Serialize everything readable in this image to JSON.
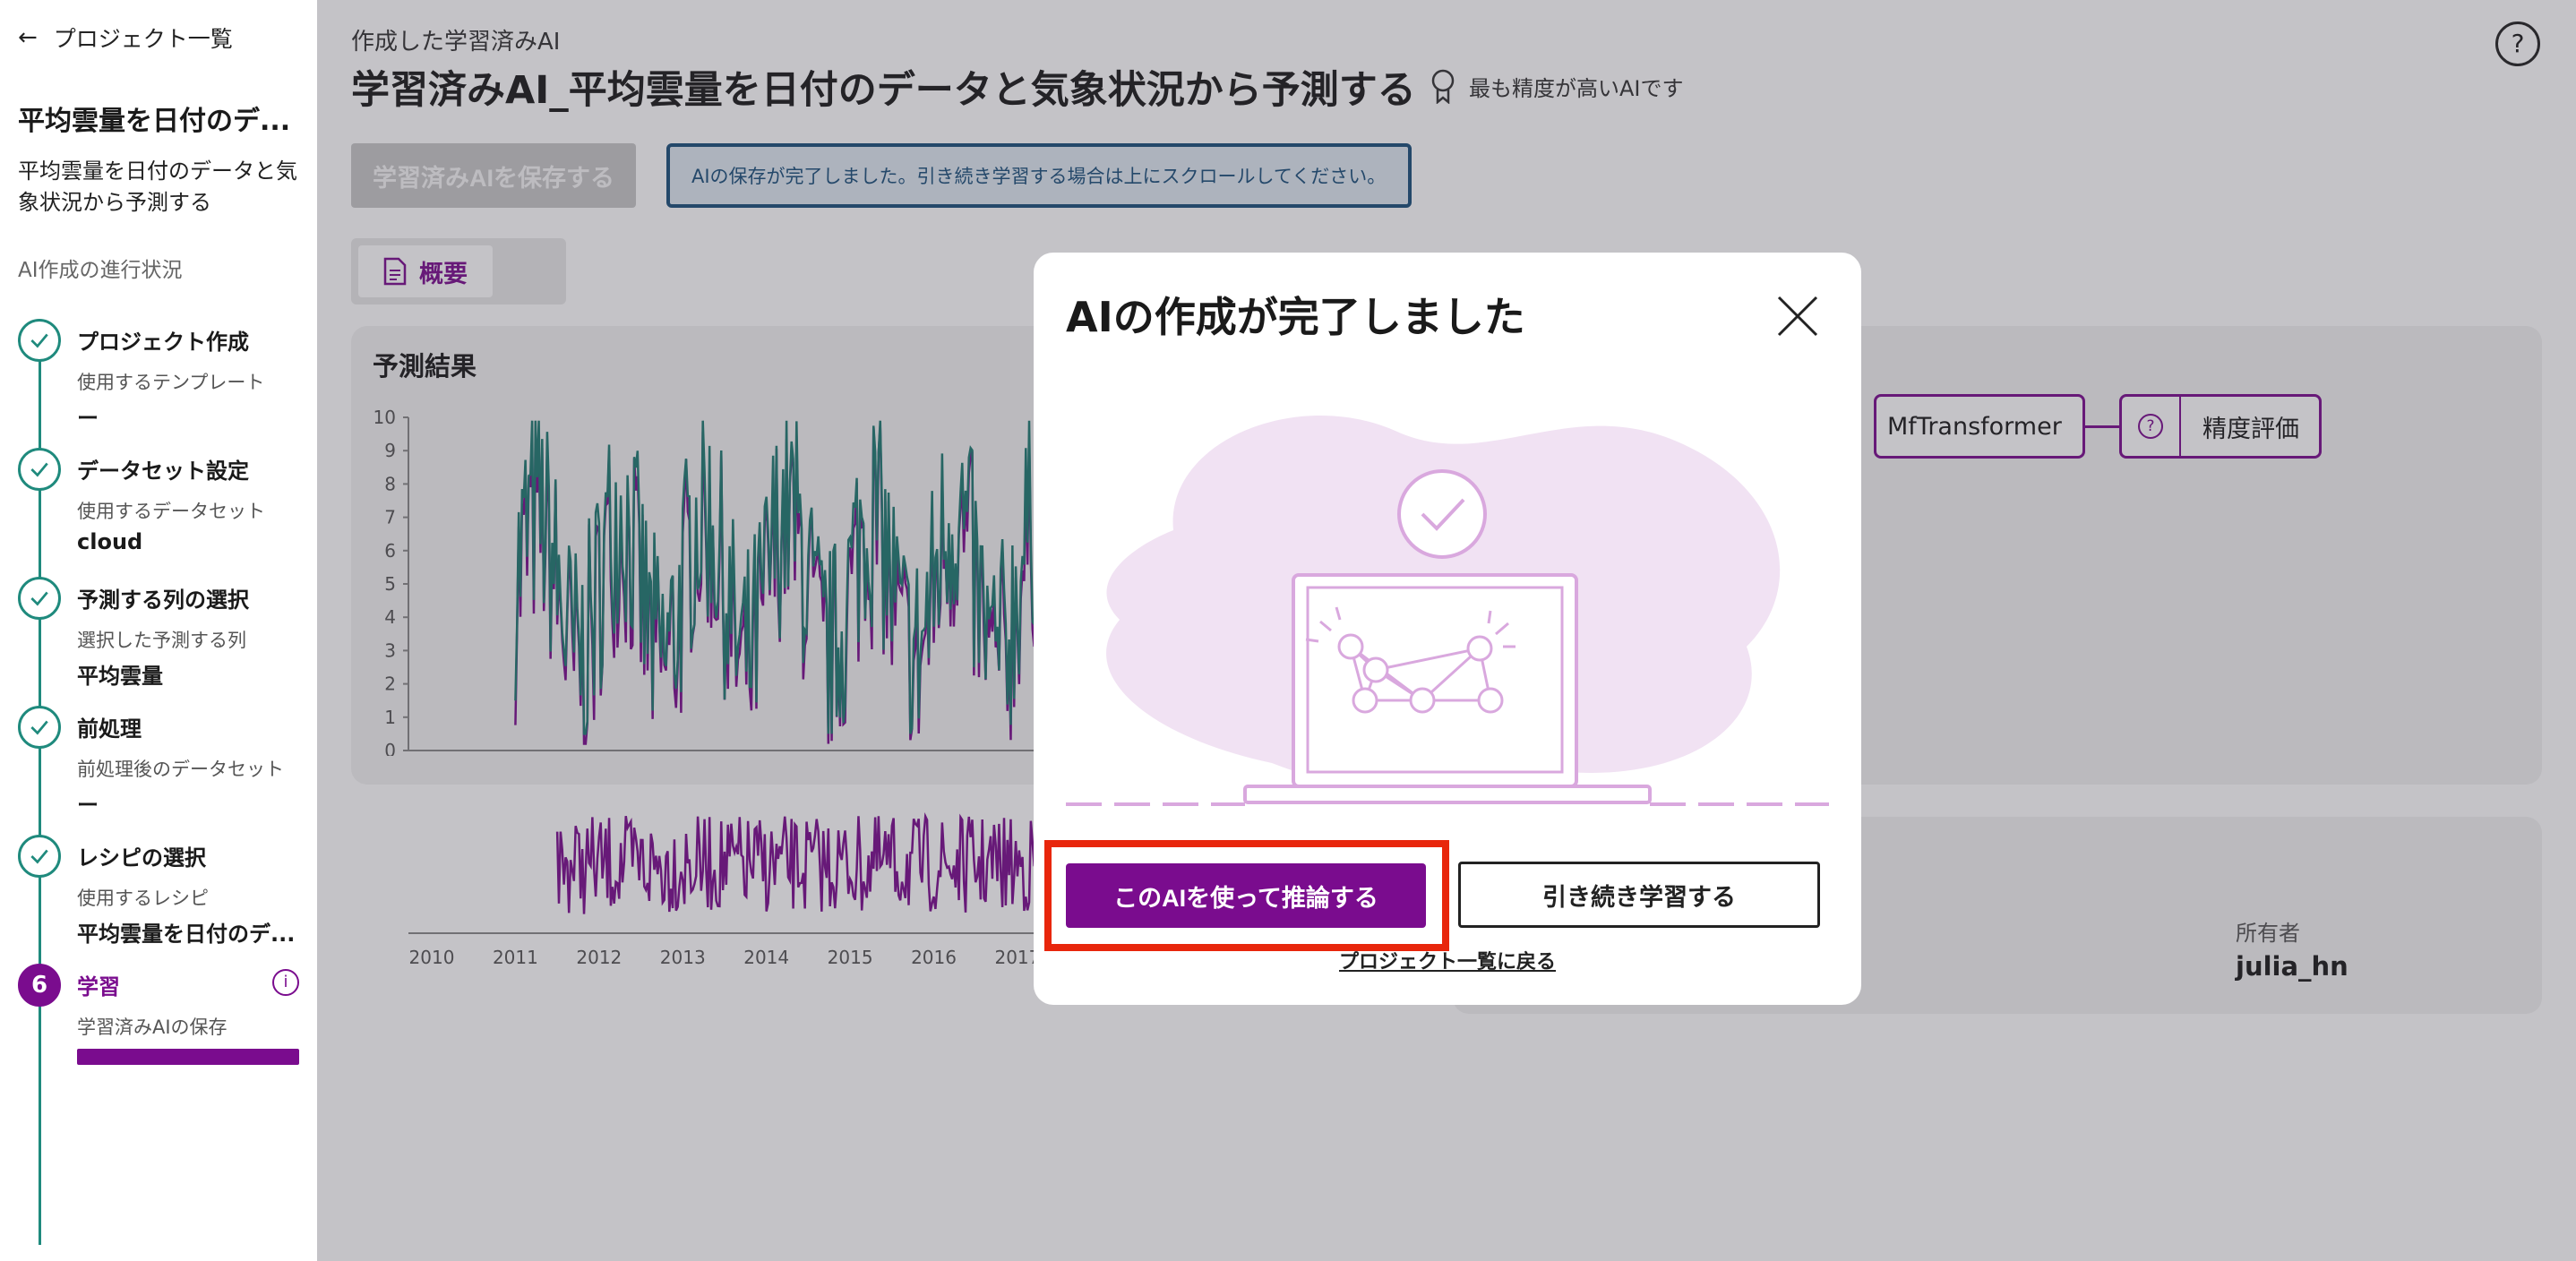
{
  "sidebar": {
    "back_label": "プロジェクト一覧",
    "project_title": "平均雲量を日付のデ...",
    "project_desc": "平均雲量を日付のデータと気象状況から予測する",
    "progress_title": "AI作成の進行状況",
    "steps": [
      {
        "name": "プロジェクト作成",
        "sub": "使用するテンプレート",
        "value": "ー",
        "status": "done"
      },
      {
        "name": "データセット設定",
        "sub": "使用するデータセット",
        "value": "cloud",
        "status": "done"
      },
      {
        "name": "予測する列の選択",
        "sub": "選択した予測する列",
        "value": "平均雲量",
        "status": "done"
      },
      {
        "name": "前処理",
        "sub": "前処理後のデータセット",
        "value": "ー",
        "status": "done"
      },
      {
        "name": "レシピの選択",
        "sub": "使用するレシピ",
        "value": "平均雲量を日付のデ...",
        "status": "done"
      },
      {
        "name": "学習",
        "sub": "学習済みAIの保存",
        "number": "6",
        "status": "active"
      }
    ]
  },
  "main": {
    "subtitle": "作成した学習済みAI",
    "title": "学習済みAI_平均雲量を日付のデータと気象状況から予測する",
    "badge": "最も精度が高いAIです",
    "save_button": "学習済みAIを保存する",
    "notice": "AIの保存が完了しました。引き続き学習する場合は上にスクロールしてください。",
    "tab_overview": "概要",
    "card_title": "予測結果",
    "flow_node_transformer": "MfTransformer",
    "flow_node_eval": "精度評価",
    "owner_label": "所有者",
    "owner_value": "julia_hn"
  },
  "modal": {
    "title": "AIの作成が完了しました",
    "primary_button": "このAIを使って推論する",
    "secondary_button": "引き続き学習する",
    "back_link": "プロジェクト一覧に戻る"
  },
  "chart_data": [
    {
      "type": "line",
      "title": "",
      "x_ticks": [
        "2010",
        "2011",
        "2012",
        "2013",
        "2014",
        "2015",
        "2016",
        "2017"
      ],
      "y_ticks": [
        "0",
        "1",
        "2",
        "3",
        "4",
        "5",
        "6",
        "7",
        "8",
        "9",
        "10"
      ],
      "ylim": [
        0,
        10
      ],
      "xlim": [
        2010,
        2017.6
      ],
      "series": [
        {
          "color": "#7a0c8e"
        },
        {
          "color": "#1f7a72"
        }
      ]
    },
    {
      "type": "line",
      "title": "",
      "x_ticks": [
        "2010",
        "2011",
        "2012",
        "2013",
        "2014",
        "2015",
        "2016",
        "2017"
      ],
      "xlim": [
        2010,
        2017.6
      ],
      "series": [
        {
          "color": "#7a0c8e"
        }
      ]
    }
  ],
  "colors": {
    "accent": "#7a0c8e",
    "teal": "#1f8a7d",
    "highlight": "#e8260c"
  }
}
